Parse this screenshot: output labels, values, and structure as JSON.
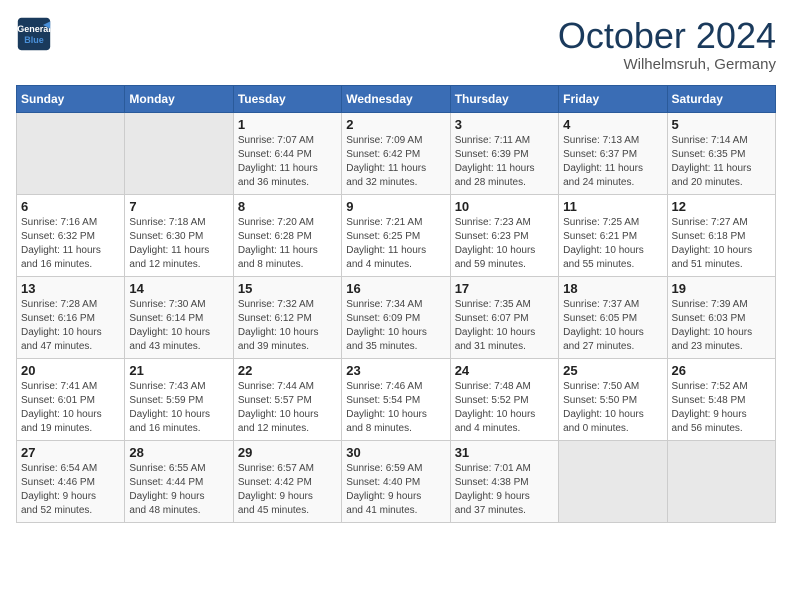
{
  "header": {
    "logo_line1": "General",
    "logo_line2": "Blue",
    "month_title": "October 2024",
    "location": "Wilhelmsruh, Germany"
  },
  "days_of_week": [
    "Sunday",
    "Monday",
    "Tuesday",
    "Wednesday",
    "Thursday",
    "Friday",
    "Saturday"
  ],
  "weeks": [
    [
      {
        "day": "",
        "info": ""
      },
      {
        "day": "",
        "info": ""
      },
      {
        "day": "1",
        "info": "Sunrise: 7:07 AM\nSunset: 6:44 PM\nDaylight: 11 hours\nand 36 minutes."
      },
      {
        "day": "2",
        "info": "Sunrise: 7:09 AM\nSunset: 6:42 PM\nDaylight: 11 hours\nand 32 minutes."
      },
      {
        "day": "3",
        "info": "Sunrise: 7:11 AM\nSunset: 6:39 PM\nDaylight: 11 hours\nand 28 minutes."
      },
      {
        "day": "4",
        "info": "Sunrise: 7:13 AM\nSunset: 6:37 PM\nDaylight: 11 hours\nand 24 minutes."
      },
      {
        "day": "5",
        "info": "Sunrise: 7:14 AM\nSunset: 6:35 PM\nDaylight: 11 hours\nand 20 minutes."
      }
    ],
    [
      {
        "day": "6",
        "info": "Sunrise: 7:16 AM\nSunset: 6:32 PM\nDaylight: 11 hours\nand 16 minutes."
      },
      {
        "day": "7",
        "info": "Sunrise: 7:18 AM\nSunset: 6:30 PM\nDaylight: 11 hours\nand 12 minutes."
      },
      {
        "day": "8",
        "info": "Sunrise: 7:20 AM\nSunset: 6:28 PM\nDaylight: 11 hours\nand 8 minutes."
      },
      {
        "day": "9",
        "info": "Sunrise: 7:21 AM\nSunset: 6:25 PM\nDaylight: 11 hours\nand 4 minutes."
      },
      {
        "day": "10",
        "info": "Sunrise: 7:23 AM\nSunset: 6:23 PM\nDaylight: 10 hours\nand 59 minutes."
      },
      {
        "day": "11",
        "info": "Sunrise: 7:25 AM\nSunset: 6:21 PM\nDaylight: 10 hours\nand 55 minutes."
      },
      {
        "day": "12",
        "info": "Sunrise: 7:27 AM\nSunset: 6:18 PM\nDaylight: 10 hours\nand 51 minutes."
      }
    ],
    [
      {
        "day": "13",
        "info": "Sunrise: 7:28 AM\nSunset: 6:16 PM\nDaylight: 10 hours\nand 47 minutes."
      },
      {
        "day": "14",
        "info": "Sunrise: 7:30 AM\nSunset: 6:14 PM\nDaylight: 10 hours\nand 43 minutes."
      },
      {
        "day": "15",
        "info": "Sunrise: 7:32 AM\nSunset: 6:12 PM\nDaylight: 10 hours\nand 39 minutes."
      },
      {
        "day": "16",
        "info": "Sunrise: 7:34 AM\nSunset: 6:09 PM\nDaylight: 10 hours\nand 35 minutes."
      },
      {
        "day": "17",
        "info": "Sunrise: 7:35 AM\nSunset: 6:07 PM\nDaylight: 10 hours\nand 31 minutes."
      },
      {
        "day": "18",
        "info": "Sunrise: 7:37 AM\nSunset: 6:05 PM\nDaylight: 10 hours\nand 27 minutes."
      },
      {
        "day": "19",
        "info": "Sunrise: 7:39 AM\nSunset: 6:03 PM\nDaylight: 10 hours\nand 23 minutes."
      }
    ],
    [
      {
        "day": "20",
        "info": "Sunrise: 7:41 AM\nSunset: 6:01 PM\nDaylight: 10 hours\nand 19 minutes."
      },
      {
        "day": "21",
        "info": "Sunrise: 7:43 AM\nSunset: 5:59 PM\nDaylight: 10 hours\nand 16 minutes."
      },
      {
        "day": "22",
        "info": "Sunrise: 7:44 AM\nSunset: 5:57 PM\nDaylight: 10 hours\nand 12 minutes."
      },
      {
        "day": "23",
        "info": "Sunrise: 7:46 AM\nSunset: 5:54 PM\nDaylight: 10 hours\nand 8 minutes."
      },
      {
        "day": "24",
        "info": "Sunrise: 7:48 AM\nSunset: 5:52 PM\nDaylight: 10 hours\nand 4 minutes."
      },
      {
        "day": "25",
        "info": "Sunrise: 7:50 AM\nSunset: 5:50 PM\nDaylight: 10 hours\nand 0 minutes."
      },
      {
        "day": "26",
        "info": "Sunrise: 7:52 AM\nSunset: 5:48 PM\nDaylight: 9 hours\nand 56 minutes."
      }
    ],
    [
      {
        "day": "27",
        "info": "Sunrise: 6:54 AM\nSunset: 4:46 PM\nDaylight: 9 hours\nand 52 minutes."
      },
      {
        "day": "28",
        "info": "Sunrise: 6:55 AM\nSunset: 4:44 PM\nDaylight: 9 hours\nand 48 minutes."
      },
      {
        "day": "29",
        "info": "Sunrise: 6:57 AM\nSunset: 4:42 PM\nDaylight: 9 hours\nand 45 minutes."
      },
      {
        "day": "30",
        "info": "Sunrise: 6:59 AM\nSunset: 4:40 PM\nDaylight: 9 hours\nand 41 minutes."
      },
      {
        "day": "31",
        "info": "Sunrise: 7:01 AM\nSunset: 4:38 PM\nDaylight: 9 hours\nand 37 minutes."
      },
      {
        "day": "",
        "info": ""
      },
      {
        "day": "",
        "info": ""
      }
    ]
  ]
}
